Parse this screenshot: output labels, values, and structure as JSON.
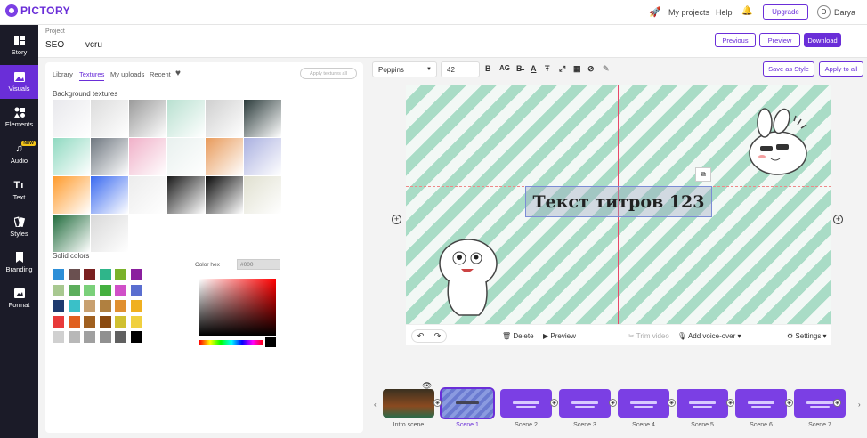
{
  "app": {
    "logo_text": "PICTORY"
  },
  "topbar": {
    "my_projects": "My projects",
    "help": "Help",
    "upgrade": "Upgrade",
    "avatar_initial": "D",
    "user_name": "Darya"
  },
  "project": {
    "label": "Project",
    "name1": "SEO",
    "name2": "vcru",
    "previous": "Previous",
    "preview": "Preview",
    "download": "Download"
  },
  "sidebar": {
    "items": [
      {
        "label": "Story",
        "icon": "story-icon"
      },
      {
        "label": "Visuals",
        "icon": "visuals-icon"
      },
      {
        "label": "Elements",
        "icon": "elements-icon"
      },
      {
        "label": "Audio",
        "icon": "audio-icon",
        "badge": "NEW"
      },
      {
        "label": "Text",
        "icon": "text-icon"
      },
      {
        "label": "Styles",
        "icon": "styles-icon"
      },
      {
        "label": "Branding",
        "icon": "branding-icon"
      },
      {
        "label": "Format",
        "icon": "format-icon"
      }
    ]
  },
  "panel": {
    "tabs": [
      "Library",
      "Textures",
      "My uploads",
      "Recent"
    ],
    "apply_all_placeholder": "Apply textures all",
    "bg_textures_title": "Background textures",
    "solid_colors_title": "Solid colors",
    "color_hex_label": "Color hex",
    "color_hex_value": "#000"
  },
  "textures": [
    "#e8e8ec",
    "#dcdcdc",
    "#9a9a9a",
    "#b8e0d0",
    "#cfcfcf",
    "#2a3a3a",
    "#8fd9c0",
    "#6f7780",
    "#f0b0c8",
    "#e8f0ee",
    "#e89a5a",
    "#aab0e0",
    "#ff9a2a",
    "#3a6af0",
    "#ececec",
    "#1a1a1a",
    "#0a0a0a",
    "#e0e0d0",
    "#1e6a3a",
    "#d8d8d8"
  ],
  "solid_colors": [
    [
      "#2d8fd8",
      "#6a5050",
      "#7a2020",
      "#2fb58a",
      "#7ab22a",
      "#8a1f9e"
    ],
    [
      "#a8c890",
      "#5cae5c",
      "#7ad07a",
      "#45b040",
      "#d050c8",
      "#5a6ed0"
    ],
    [
      "#1e3a6e",
      "#3ac0c8",
      "#c8a070",
      "#b08040",
      "#e09030",
      "#f0b020"
    ],
    [
      "#e83a3a",
      "#e06020",
      "#a06020",
      "#8a4a10",
      "#d0c030",
      "#f0d040"
    ],
    [
      "#d0d0d0",
      "#b8b8b8",
      "#a0a0a0",
      "#909090",
      "#606060",
      "#000000"
    ]
  ],
  "toolbar": {
    "font": "Poppins",
    "size": "42",
    "save_style": "Save as Style",
    "apply_all": "Apply to all"
  },
  "canvas": {
    "title_text": "Текст титров 123"
  },
  "stagebar": {
    "delete": "Delete",
    "preview": "Preview",
    "trim": "Trim video",
    "voice": "Add voice-over",
    "settings": "Settings"
  },
  "scenes": [
    "Intro scene",
    "Scene 1",
    "Scene 2",
    "Scene 3",
    "Scene 4",
    "Scene 5",
    "Scene 6",
    "Scene 7"
  ],
  "colors": {
    "accent": "#6a2ed8",
    "sidebar_bg": "#1b1b28"
  }
}
